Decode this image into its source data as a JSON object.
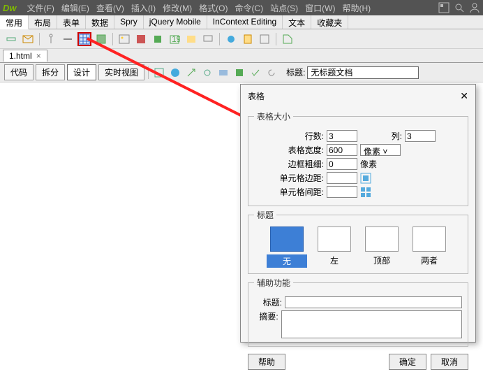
{
  "menu": {
    "logo": "Dw",
    "items": [
      "文件(F)",
      "编辑(E)",
      "查看(V)",
      "插入(I)",
      "修改(M)",
      "格式(O)",
      "命令(C)",
      "站点(S)",
      "窗口(W)",
      "帮助(H)"
    ]
  },
  "tabs": {
    "items": [
      "常用",
      "布局",
      "表单",
      "数据",
      "Spry",
      "jQuery Mobile",
      "InContext Editing",
      "文本",
      "收藏夹"
    ],
    "active": 0
  },
  "doc": {
    "name": "1.html"
  },
  "viewbar": {
    "code": "代码",
    "split": "拆分",
    "design": "设计",
    "live": "实时视图",
    "titleLabel": "标题:",
    "titleValue": "无标题文档"
  },
  "dialog": {
    "title": "表格",
    "size": {
      "legend": "表格大小",
      "rowsLabel": "行数:",
      "rows": "3",
      "colsLabel": "列:",
      "cols": "3",
      "widthLabel": "表格宽度:",
      "width": "600",
      "widthUnit": "像素",
      "borderLabel": "边框粗细:",
      "border": "0",
      "borderUnit": "像素",
      "padLabel": "单元格边距:",
      "pad": "",
      "spcLabel": "单元格间距:",
      "spc": ""
    },
    "header": {
      "legend": "标题",
      "none": "无",
      "left": "左",
      "top": "顶部",
      "both": "两者"
    },
    "a11y": {
      "legend": "辅助功能",
      "captionLabel": "标题:",
      "caption": "",
      "summaryLabel": "摘要:",
      "summary": ""
    },
    "buttons": {
      "help": "帮助",
      "ok": "确定",
      "cancel": "取消"
    }
  }
}
